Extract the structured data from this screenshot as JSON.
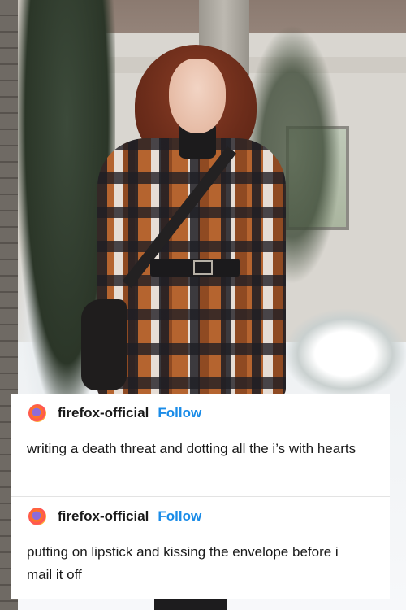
{
  "posts": [
    {
      "username": "firefox-official",
      "follow_label": "Follow",
      "text": "writing a death threat and dotting all the i’s with hearts"
    },
    {
      "username": "firefox-official",
      "follow_label": "Follow",
      "text": "putting on lipstick and kissing the envelope before i mail it off"
    }
  ],
  "colors": {
    "follow": "#1a8ce8",
    "card_background": "#ffffff",
    "text": "#1a1a1a"
  },
  "icons": {
    "avatar": "firefox-logo-icon"
  }
}
